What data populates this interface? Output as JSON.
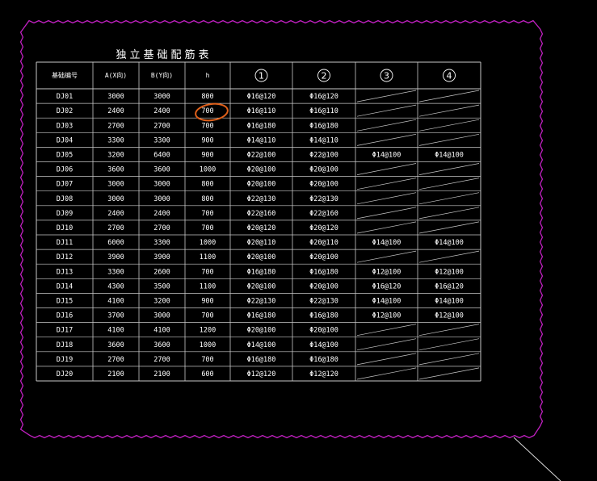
{
  "colors": {
    "background": "#000000",
    "table_lines": "#c8c8c8",
    "text": "#ffffff",
    "selection_boundary": "#c020c0",
    "markup_circle": "#e0601a"
  },
  "table": {
    "title": "独立基础配筋表",
    "headers": [
      "基础编号",
      "A(X向)",
      "B(Y向)",
      "h",
      "1",
      "2",
      "3",
      "4"
    ],
    "rows": [
      [
        "DJ01",
        "3000",
        "3000",
        "800",
        "Φ16@120",
        "Φ16@120",
        "",
        ""
      ],
      [
        "DJ02",
        "2400",
        "2400",
        "700",
        "Φ16@110",
        "Φ16@110",
        "",
        ""
      ],
      [
        "DJ03",
        "2700",
        "2700",
        "700",
        "Φ16@180",
        "Φ16@180",
        "",
        ""
      ],
      [
        "DJ04",
        "3300",
        "3300",
        "900",
        "Φ14@110",
        "Φ14@110",
        "",
        ""
      ],
      [
        "DJ05",
        "3200",
        "6400",
        "900",
        "Φ22@100",
        "Φ22@100",
        "Φ14@100",
        "Φ14@100"
      ],
      [
        "DJ06",
        "3600",
        "3600",
        "1000",
        "Φ20@100",
        "Φ20@100",
        "",
        ""
      ],
      [
        "DJ07",
        "3000",
        "3000",
        "800",
        "Φ20@100",
        "Φ20@100",
        "",
        ""
      ],
      [
        "DJ08",
        "3000",
        "3000",
        "800",
        "Φ22@130",
        "Φ22@130",
        "",
        ""
      ],
      [
        "DJ09",
        "2400",
        "2400",
        "700",
        "Φ22@160",
        "Φ22@160",
        "",
        ""
      ],
      [
        "DJ10",
        "2700",
        "2700",
        "700",
        "Φ20@120",
        "Φ20@120",
        "",
        ""
      ],
      [
        "DJ11",
        "6000",
        "3300",
        "1000",
        "Φ20@110",
        "Φ20@110",
        "Φ14@100",
        "Φ14@100"
      ],
      [
        "DJ12",
        "3900",
        "3900",
        "1100",
        "Φ20@100",
        "Φ20@100",
        "",
        ""
      ],
      [
        "DJ13",
        "3300",
        "2600",
        "700",
        "Φ16@180",
        "Φ16@180",
        "Φ12@100",
        "Φ12@100"
      ],
      [
        "DJ14",
        "4300",
        "3500",
        "1100",
        "Φ20@100",
        "Φ20@100",
        "Φ16@120",
        "Φ16@120"
      ],
      [
        "DJ15",
        "4100",
        "3200",
        "900",
        "Φ22@130",
        "Φ22@130",
        "Φ14@100",
        "Φ14@100"
      ],
      [
        "DJ16",
        "3700",
        "3000",
        "700",
        "Φ16@180",
        "Φ16@180",
        "Φ12@100",
        "Φ12@100"
      ],
      [
        "DJ17",
        "4100",
        "4100",
        "1200",
        "Φ20@100",
        "Φ20@100",
        "",
        ""
      ],
      [
        "DJ18",
        "3600",
        "3600",
        "1000",
        "Φ14@100",
        "Φ14@100",
        "",
        ""
      ],
      [
        "DJ19",
        "2700",
        "2700",
        "700",
        "Φ16@180",
        "Φ16@180",
        "",
        ""
      ],
      [
        "DJ20",
        "2100",
        "2100",
        "600",
        "Φ12@120",
        "Φ12@120",
        "",
        ""
      ]
    ]
  }
}
